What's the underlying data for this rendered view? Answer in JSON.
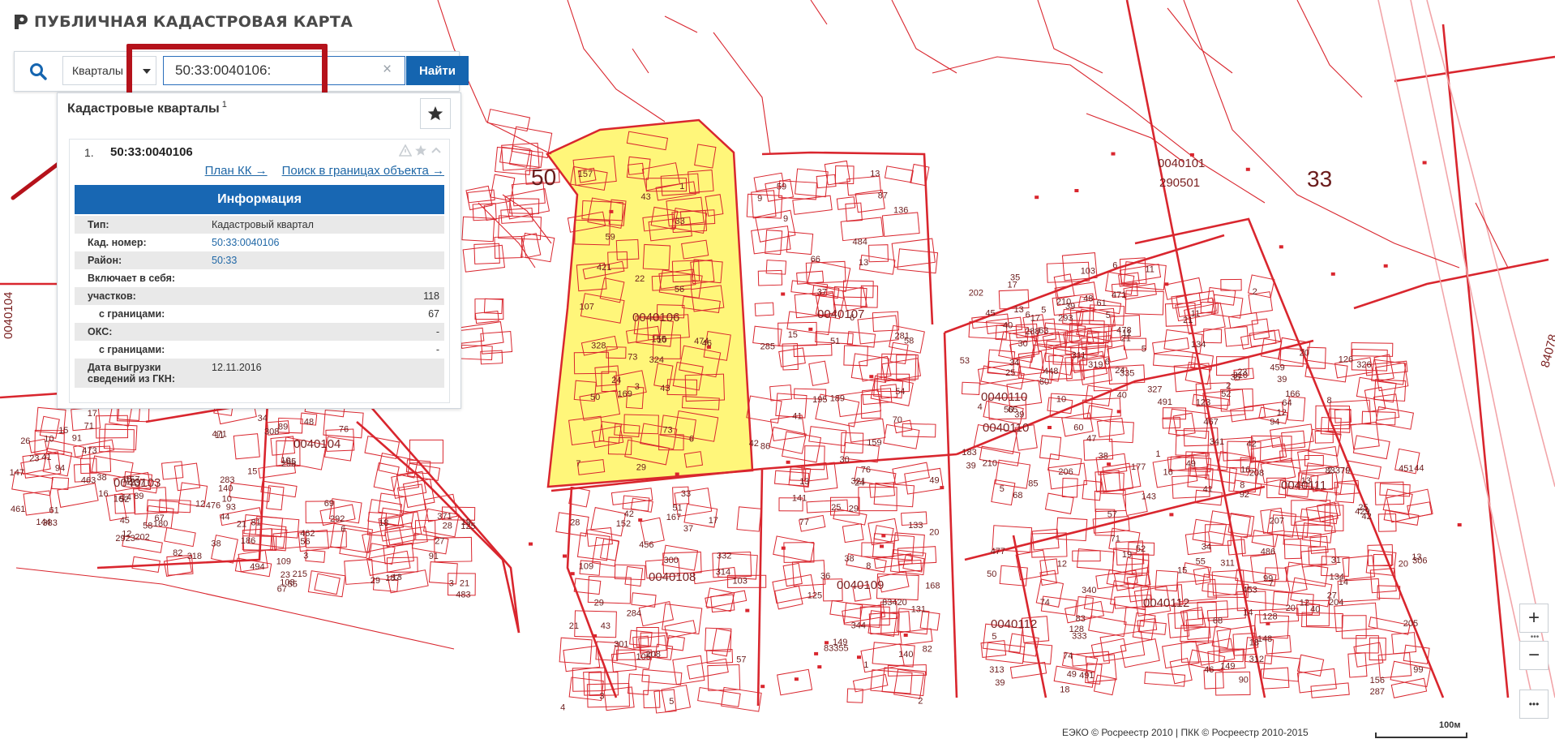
{
  "header": {
    "title": "ПУБЛИЧНАЯ КАДАСТРОВАЯ КАРТА"
  },
  "search": {
    "type_selected": "Кварталы",
    "query": "50:33:0040106:",
    "button_label": "Найти"
  },
  "results": {
    "title": "Кадастровые кварталы",
    "count": "1",
    "item": {
      "index": "1.",
      "number": "50:33:0040106",
      "links": [
        "План КК →",
        "Поиск в границах объекта →"
      ],
      "info_title": "Информация",
      "rows": [
        {
          "label": "Тип:",
          "value": "Кадастровый квартал"
        },
        {
          "label": "Кад. номер:",
          "value": "50:33:0040106"
        },
        {
          "label": "Район:",
          "value": "50:33"
        },
        {
          "label": "Включает в себя:",
          "value": ""
        },
        {
          "label": "участков:",
          "value": "118"
        },
        {
          "label": "с границами:",
          "value": "67"
        },
        {
          "label": "ОКС:",
          "value": "-"
        },
        {
          "label": "с границами:",
          "value": "-"
        },
        {
          "label": "Дата выгрузки сведений из ГКН:",
          "value": "12.11.2016"
        }
      ]
    }
  },
  "map": {
    "highlight_color": "#fff67a",
    "line_color": "#d9262e",
    "labels": {
      "big": [
        "50",
        "33"
      ],
      "quarters": [
        "0040101",
        "290501",
        "0040106",
        "0040107",
        "0040110",
        "0040110",
        "0040104",
        "0040103",
        "0040104",
        "0040108",
        "0040109",
        "0040112",
        "0040112",
        "0040111",
        "84078"
      ],
      "parcels": [
        "107",
        "41",
        "125",
        "109",
        "39",
        "85",
        "42",
        "92",
        "13",
        "99",
        "10",
        "82",
        "69",
        "6",
        "46",
        "66",
        "77",
        "28",
        "63",
        "50",
        "52",
        "15",
        "42",
        "59",
        "26",
        "38",
        "56",
        "25",
        "43",
        "37",
        "36",
        "17",
        "34",
        "39",
        "8",
        "68",
        "31",
        "89",
        "45",
        "44",
        "27",
        "35",
        "50",
        "59",
        "29",
        "57",
        "45",
        "49",
        "41",
        "46",
        "83379",
        "24",
        "16",
        "2923",
        "67",
        "11",
        "56",
        "70",
        "8",
        "3",
        "60",
        "57",
        "64",
        "128",
        "14",
        "48",
        "41",
        "81",
        "108",
        "13",
        "73",
        "58",
        "24",
        "37",
        "38",
        "83",
        "35",
        "40",
        "25",
        "76",
        "71",
        "12",
        "91",
        "60",
        "33",
        "87",
        "49",
        "43",
        "65",
        "74",
        "16",
        "12",
        "2",
        "65",
        "61",
        "58",
        "55",
        "327",
        "421",
        "51",
        "141",
        "21",
        "48",
        "19",
        "12",
        "18",
        "20",
        "471",
        "23",
        "140",
        "28",
        "30",
        "22",
        "54",
        "83420",
        "4",
        "40",
        "52",
        "39",
        "453",
        "451",
        "455",
        "461",
        "494",
        "462",
        "288",
        "324",
        "285",
        "344",
        "300",
        "448",
        "477",
        "467",
        "486",
        "429",
        "490",
        "473",
        "476",
        "483",
        "471",
        "474",
        "484",
        "13",
        "456",
        "478",
        "491",
        "459",
        "7",
        "326",
        "19",
        "463",
        "10",
        "23",
        "293",
        "24",
        "15",
        "83355",
        "284",
        "183",
        "340",
        "491",
        "311",
        "306",
        "342",
        "94",
        "318",
        "29",
        "335",
        "328",
        "30",
        "321",
        "332",
        "319",
        "333",
        "310",
        "341",
        "27",
        "17",
        "15",
        "283",
        "292",
        "5",
        "43",
        "195",
        "2",
        "208",
        "210",
        "313",
        "11",
        "312",
        "287",
        "308",
        "144",
        "202",
        "187",
        "5",
        "6",
        "281",
        "38",
        "301",
        "210",
        "206",
        "21",
        "207",
        "134",
        "298",
        "17",
        "186",
        "13",
        "5",
        "10",
        "136",
        "133",
        "314",
        "311",
        "5",
        "2",
        "49",
        "205",
        "62",
        "383",
        "109",
        "19",
        "21",
        "157",
        "42",
        "149",
        "152",
        "4",
        "177",
        "1",
        "14",
        "13",
        "11",
        "16",
        "93",
        "125",
        "103",
        "155",
        "86",
        "25",
        "33",
        "53",
        "143",
        "94",
        "149",
        "99",
        "4",
        "16",
        "52",
        "21",
        "24",
        "59",
        "6",
        "168",
        "105",
        "10",
        "68",
        "134",
        "55",
        "156",
        "117",
        "91",
        "67",
        "371",
        "6",
        "73",
        "159",
        "140",
        "167",
        "17",
        "12",
        "123",
        "90",
        "204",
        "201",
        "89",
        "180",
        "215",
        "39",
        "169",
        "189",
        "20",
        "103",
        "202",
        "18",
        "208",
        "148",
        "126",
        "8",
        "147",
        "237",
        "3",
        "11",
        "1",
        "13",
        "82",
        "51",
        "40",
        "74",
        "23",
        "20",
        "20",
        "7",
        "14",
        "15",
        "6",
        "17",
        "29",
        "13",
        "131",
        "29",
        "39",
        "5",
        "16",
        "99",
        "44",
        "34",
        "157",
        "12",
        "18",
        "61",
        "3",
        "9",
        "76",
        "42",
        "50",
        "128",
        "166",
        "34",
        "8",
        "10",
        "38",
        "21",
        "3",
        "6",
        "7",
        "9",
        "1",
        "5",
        "47",
        "71",
        "2"
      ]
    }
  },
  "controls": {
    "zoom_in": "+",
    "zoom_out": "−",
    "more": "•••"
  },
  "footer": {
    "copyright": "ЕЭКО © Росреестр 2010 | ПКК © Росреестр 2010-2015",
    "scale": "100м"
  }
}
